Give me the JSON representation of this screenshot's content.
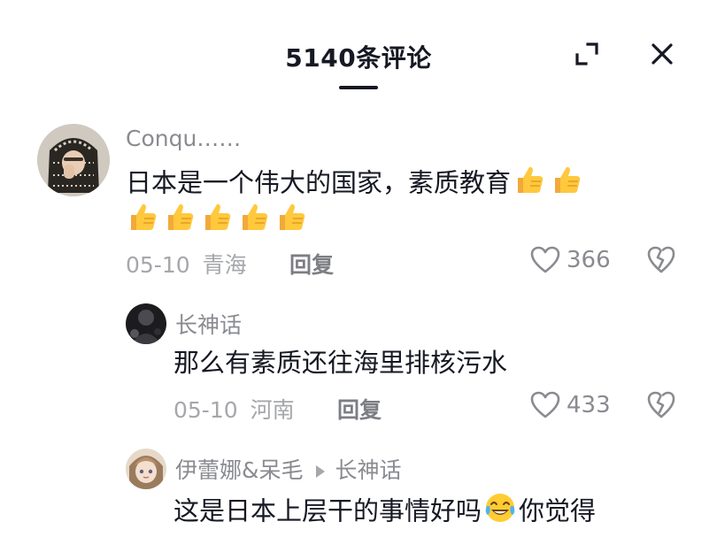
{
  "header": {
    "title": "5140条评论"
  },
  "comments": [
    {
      "author": "Conqu……",
      "text_line1": "日本是一个伟大的国家，素质教育",
      "date": "05-10",
      "location": "青海",
      "reply_label": "回复",
      "likes": "366",
      "thumbs_line1": 2,
      "thumbs_line2": 5
    },
    {
      "author": "长神话",
      "text": "那么有素质还往海里排核污水",
      "date": "05-10",
      "location": "河南",
      "reply_label": "回复",
      "likes": "433"
    },
    {
      "author": "伊蕾娜&呆毛",
      "reply_to": "长神话",
      "text_before": "这是日本上层干的事情好吗",
      "text_after": "你觉得"
    }
  ],
  "icons": {
    "expand": "expand-icon",
    "close": "close-icon",
    "like": "heart-outline-icon",
    "dislike": "broken-heart-icon",
    "thumbs_up": "thumbs-up-emoji",
    "laugh": "tears-of-joy-emoji"
  }
}
